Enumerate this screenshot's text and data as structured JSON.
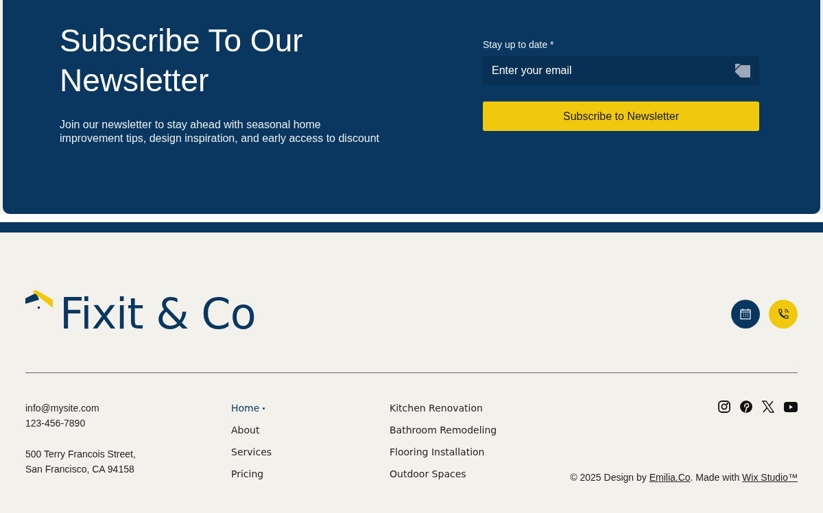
{
  "newsletter": {
    "title": "Subscribe To Our Newsletter",
    "text": "Join our newsletter to stay ahead with seasonal home improvement tips, design inspiration, and early access to discount",
    "field_label": "Stay up to date *",
    "email": {
      "placeholder": "Enter your email"
    },
    "button": "Subscribe to Newsletter"
  },
  "footer": {
    "logo": "Fixit & Co",
    "contact": [
      {
        "text": "info@mysite.com"
      },
      {
        "text": "123-456-7890"
      },
      {
        "text": "500 Terry Francois Street,"
      },
      {
        "text": "San Francisco, CA 94158"
      }
    ],
    "nav": [
      {
        "label": "Home",
        "selected": true
      },
      {
        "label": "About",
        "selected": false
      },
      {
        "label": "Services",
        "selected": false
      },
      {
        "label": "Pricing",
        "selected": false
      }
    ],
    "services": [
      "Kitchen Renovation",
      "Bathroom Remodeling",
      "Flooring Installation",
      "Outdoor Spaces"
    ],
    "copyright": {
      "before": "© 2025 Design by ",
      "link_1": "Emilia.Co",
      "middle": ". Made with ",
      "link_2": "Wix Studio™"
    }
  }
}
